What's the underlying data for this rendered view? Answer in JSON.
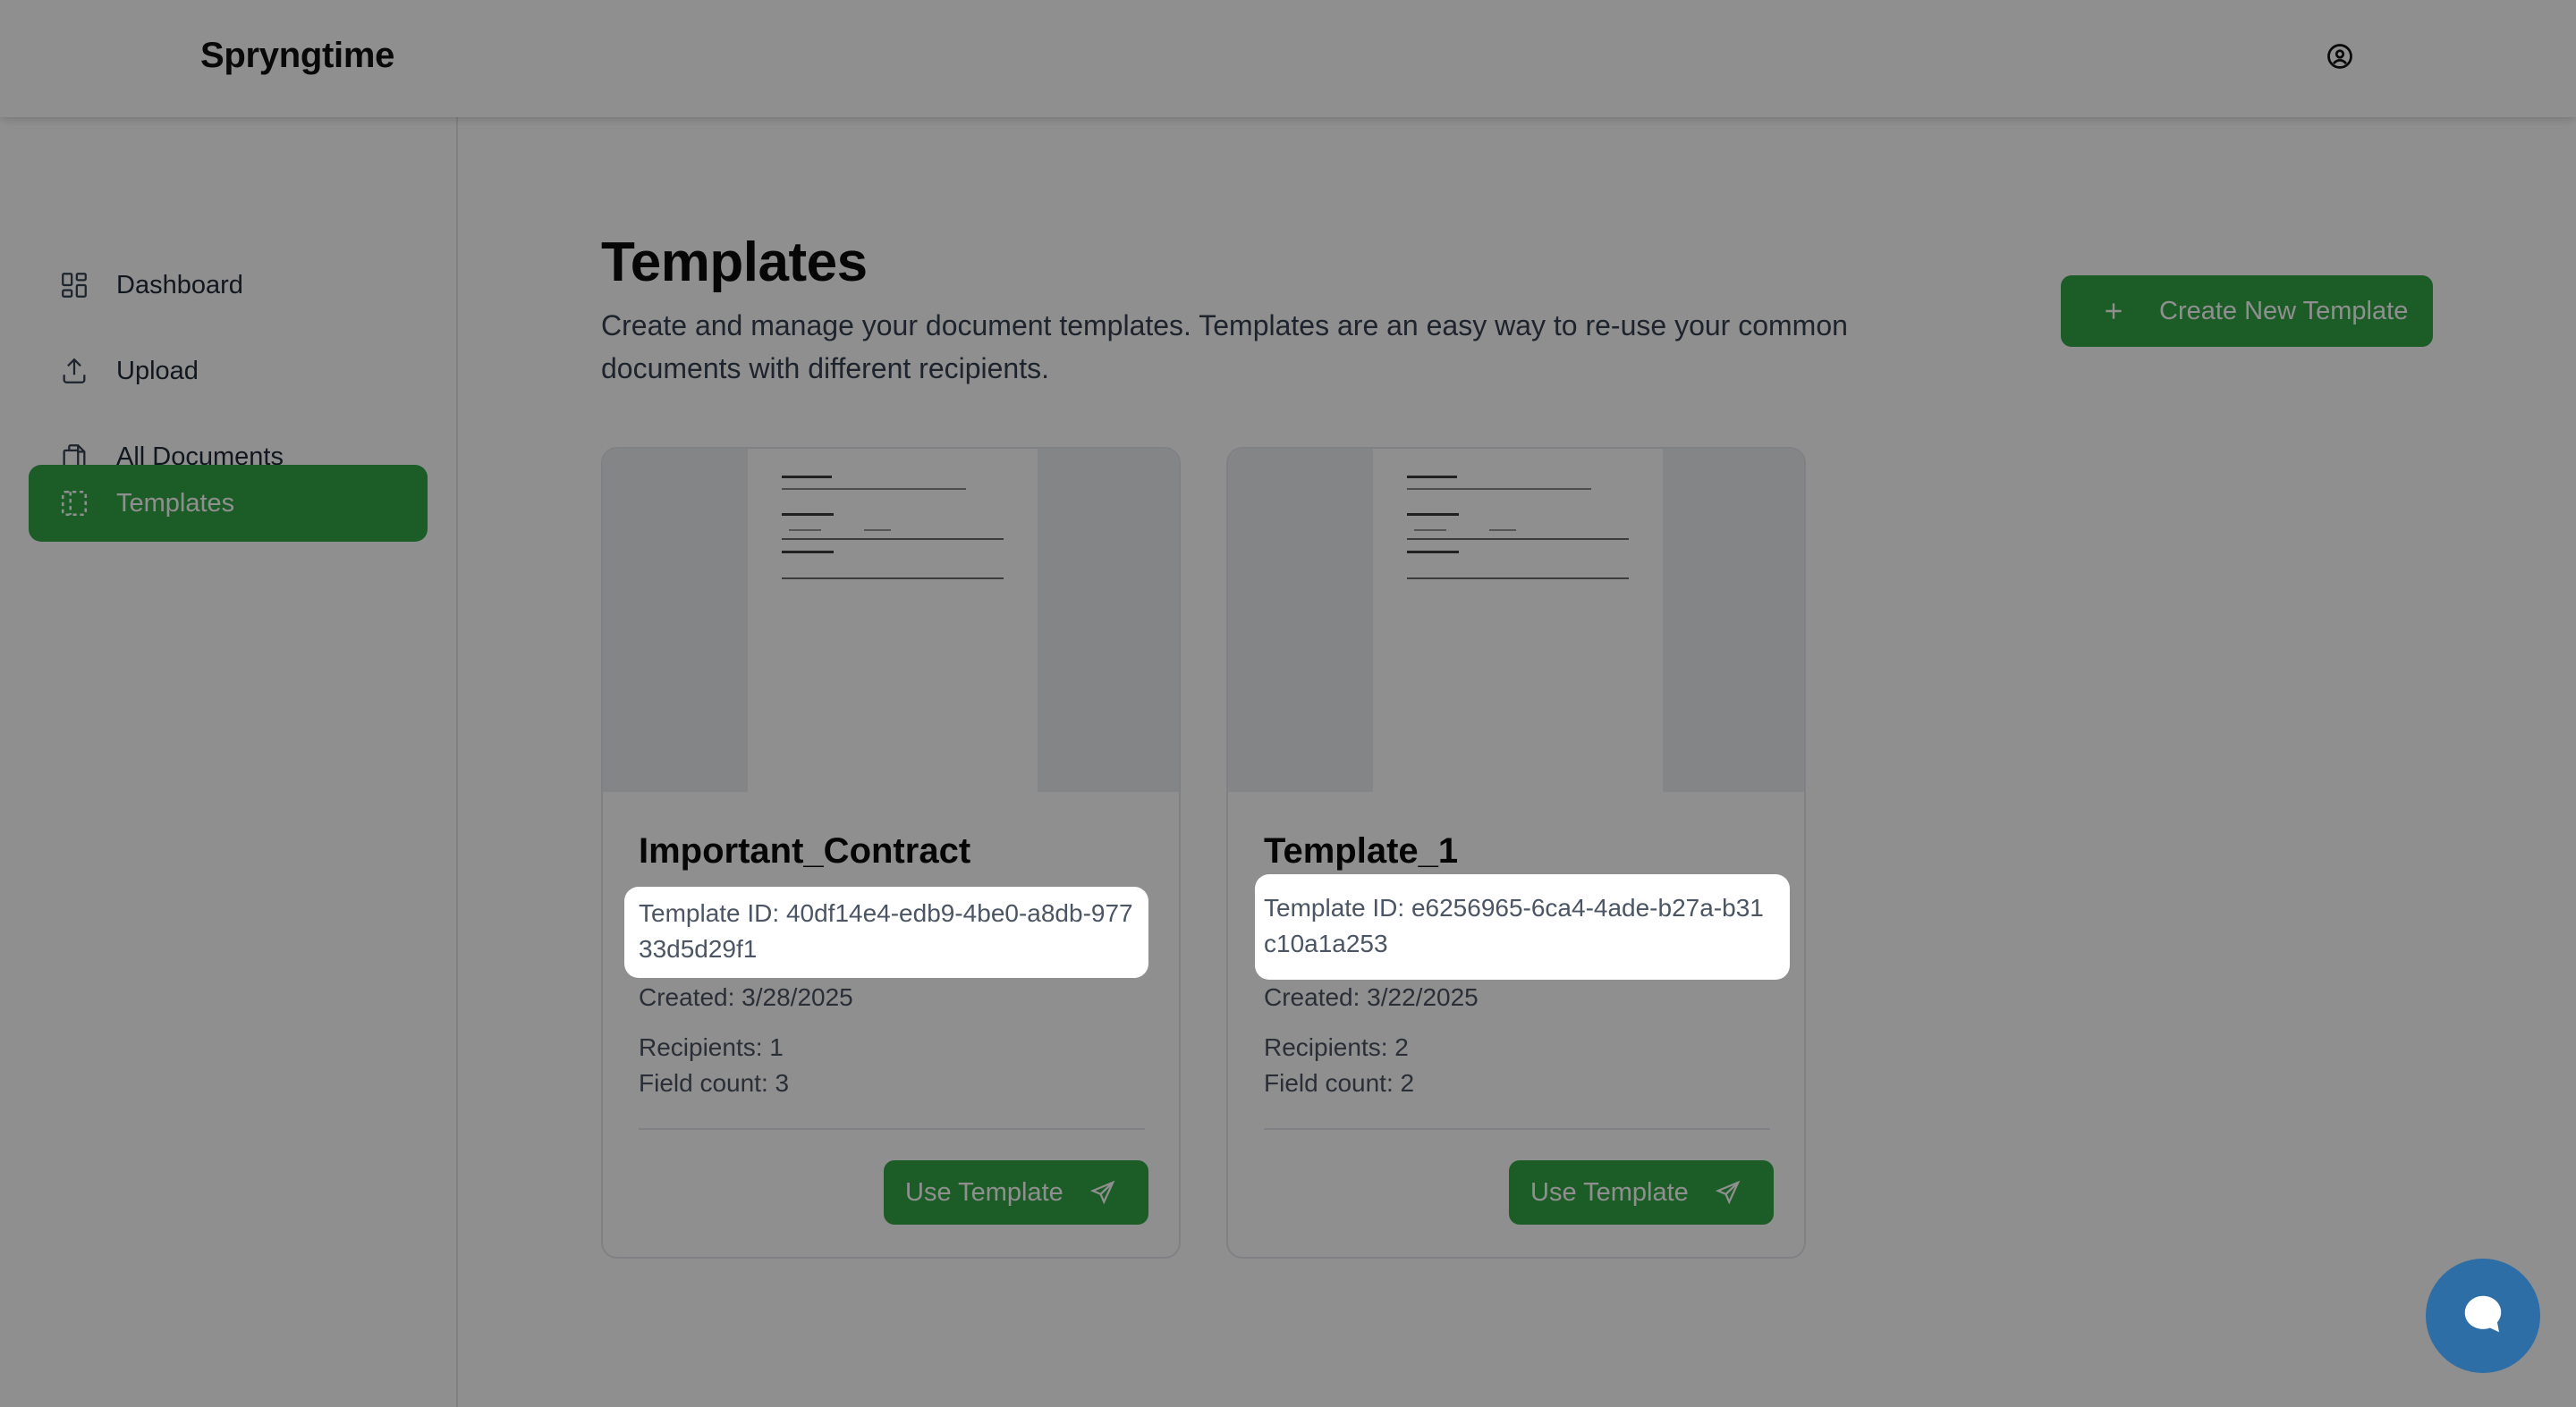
{
  "app": {
    "brand": "Spryngtime"
  },
  "header": {
    "account_icon": "user-circle-icon"
  },
  "sidebar": {
    "items": [
      {
        "label": "Dashboard",
        "icon": "dashboard-icon",
        "active": false
      },
      {
        "label": "Upload",
        "icon": "upload-icon",
        "active": false
      },
      {
        "label": "All Documents",
        "icon": "documents-icon",
        "active": false
      },
      {
        "label": "Templates",
        "icon": "templates-icon",
        "active": true
      }
    ]
  },
  "main": {
    "title": "Templates",
    "description": "Create and manage your document templates. Templates are an easy way to re-use your common documents with different recipients.",
    "create_button_label": "Create New Template",
    "templates": [
      {
        "name": "Important_Contract",
        "template_id": "Template ID: 40df14e4-edb9-4be0-a8db-97733d5d29f1",
        "created": "Created: 3/28/2025",
        "recipients": "Recipients: 1",
        "field_count": "Field count: 3",
        "use_label": "Use Template"
      },
      {
        "name": "Template_1",
        "template_id": "Template ID: e6256965-6ca4-4ade-b27a-b31c10a1a253",
        "created": "Created: 3/22/2025",
        "recipients": "Recipients: 2",
        "field_count": "Field count: 2",
        "use_label": "Use Template"
      }
    ]
  },
  "colors": {
    "accent": "#33a546",
    "chat_bubble": "#2e6ea6",
    "overlay": "rgba(0,0,0,0.44)"
  },
  "chat": {
    "icon": "chat-bubble-icon"
  }
}
